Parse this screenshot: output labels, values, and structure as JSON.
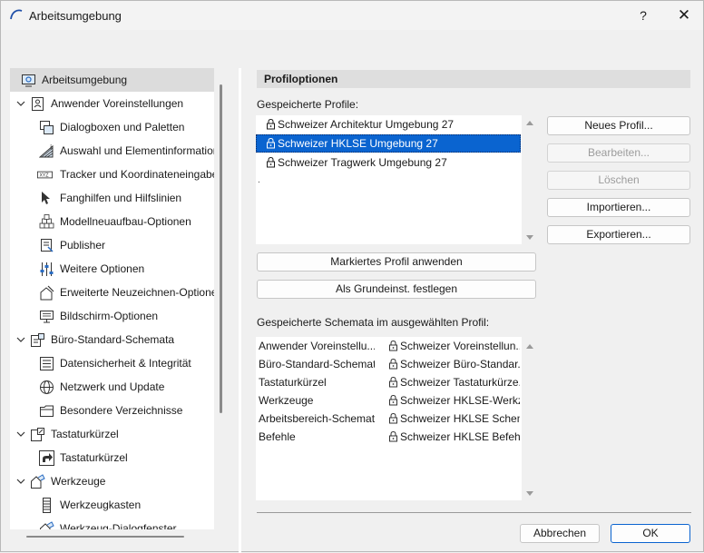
{
  "window": {
    "title": "Arbeitsumgebung",
    "help_label": "?",
    "close_label": "✕"
  },
  "tree": {
    "items": [
      {
        "label": "Arbeitsumgebung",
        "icon": "workspace-icon",
        "level": 0,
        "expander": "none",
        "selected": true
      },
      {
        "label": "Anwender Voreinstellungen",
        "icon": "user-settings-icon",
        "level": 0,
        "expander": "expanded"
      },
      {
        "label": "Dialogboxen und Paletten",
        "icon": "dialog-palettes-icon",
        "level": 1
      },
      {
        "label": "Auswahl und Elementinformation",
        "icon": "selection-info-icon",
        "level": 1
      },
      {
        "label": "Tracker und Koordinateneingabe",
        "icon": "tracker-xyz-icon",
        "level": 1
      },
      {
        "label": "Fanghilfen und Hilfslinien",
        "icon": "snap-guides-icon",
        "level": 1
      },
      {
        "label": "Modellneuaufbau-Optionen",
        "icon": "model-rebuild-icon",
        "level": 1
      },
      {
        "label": "Publisher",
        "icon": "publisher-icon",
        "level": 1
      },
      {
        "label": "Weitere Optionen",
        "icon": "sliders-icon",
        "level": 1
      },
      {
        "label": "Erweiterte Neuzeichnen-Optionen",
        "icon": "redraw-options-icon",
        "level": 1
      },
      {
        "label": "Bildschirm-Optionen",
        "icon": "monitor-icon",
        "level": 1
      },
      {
        "label": "Büro-Standard-Schemata",
        "icon": "office-standard-icon",
        "level": 0,
        "expander": "expanded"
      },
      {
        "label": "Datensicherheit & Integrität",
        "icon": "data-safety-icon",
        "level": 1
      },
      {
        "label": "Netzwerk und Update",
        "icon": "globe-icon",
        "level": 1
      },
      {
        "label": "Besondere Verzeichnisse",
        "icon": "folder-icon",
        "level": 1
      },
      {
        "label": "Tastaturkürzel",
        "icon": "shortcuts-icon",
        "level": 0,
        "expander": "expanded"
      },
      {
        "label": "Tastaturkürzel",
        "icon": "shortcut-arrow-icon",
        "level": 1
      },
      {
        "label": "Werkzeuge",
        "icon": "tools-icon",
        "level": 0,
        "expander": "expanded"
      },
      {
        "label": "Werkzeugkasten",
        "icon": "toolbox-icon",
        "level": 1
      },
      {
        "label": "Werkzeug-Dialogfenster",
        "icon": "tool-dialog-icon",
        "level": 1
      }
    ]
  },
  "profiles": {
    "section_title": "Profiloptionen",
    "saved_label": "Gespeicherte Profile:",
    "items": [
      {
        "name": "Schweizer Architektur Umgebung 27",
        "selected": false
      },
      {
        "name": "Schweizer HKLSE Umgebung 27",
        "selected": true
      },
      {
        "name": "Schweizer Tragwerk Umgebung 27",
        "selected": false
      }
    ],
    "trailing_mark": ".",
    "buttons": {
      "new": "Neues Profil...",
      "edit": "Bearbeiten...",
      "delete": "Löschen",
      "import": "Importieren...",
      "export": "Exportieren..."
    },
    "apply_label": "Markiertes Profil anwenden",
    "default_label": "Als Grundeinst. festlegen"
  },
  "schemes": {
    "label": "Gespeicherte Schemata im ausgewählten Profil:",
    "rows": [
      {
        "category": "Anwender Voreinstellu...",
        "value": "Schweizer Voreinstellun..."
      },
      {
        "category": "Büro-Standard-Schemata",
        "value": "Schweizer Büro-Standar..."
      },
      {
        "category": "Tastaturkürzel",
        "value": "Schweizer Tastaturkürze..."
      },
      {
        "category": "Werkzeuge",
        "value": "Schweizer HKLSE-Werkz..."
      },
      {
        "category": "Arbeitsbereich-Schemata",
        "value": "Schweizer HKLSE Schem..."
      },
      {
        "category": "Befehle",
        "value": "Schweizer HKLSE Befehl..."
      }
    ]
  },
  "footer": {
    "cancel": "Abbrechen",
    "ok": "OK"
  },
  "colors": {
    "selection": "#0a64d0",
    "tree_selected": "#dcdcdc",
    "panel_bg": "#f0f0f0"
  }
}
